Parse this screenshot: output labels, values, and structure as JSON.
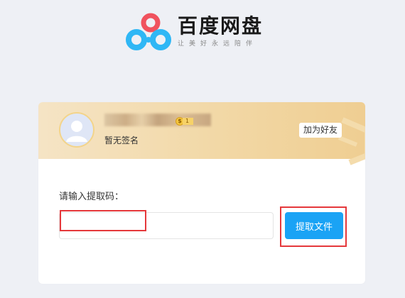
{
  "logo": {
    "title": "百度网盘",
    "slogan": "让美好永远陪伴"
  },
  "share": {
    "level_label": "1",
    "signature": "暂无签名",
    "add_friend_label": "加为好友"
  },
  "extract": {
    "prompt": "请输入提取码：",
    "input_value": "",
    "input_placeholder": "",
    "submit_label": "提取文件"
  },
  "colors": {
    "accent": "#1aa3f5",
    "highlight": "#e5383b",
    "logo_red": "#f0525e",
    "logo_blue": "#2fb7f5"
  }
}
